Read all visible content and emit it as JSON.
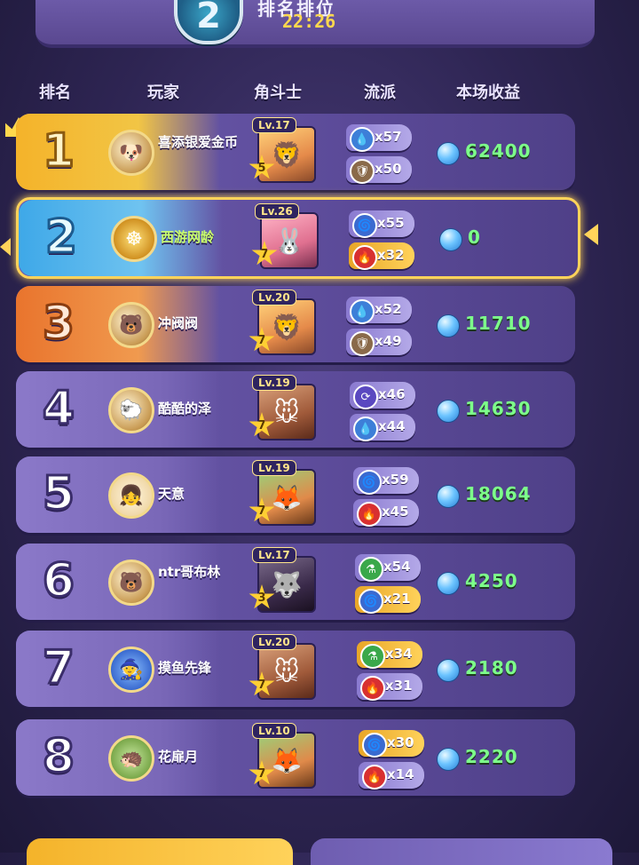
{
  "header": {
    "title": "排名排位",
    "rank_emblem": "2",
    "time": "22:26"
  },
  "columns": {
    "rank": "排名",
    "player": "玩家",
    "fighter": "角斗士",
    "school": "流派",
    "earnings": "本场收益"
  },
  "rows": [
    {
      "rank": "1",
      "name": "喜添银爱金币",
      "level": "Lv.17",
      "star": "5",
      "school_a": {
        "icon": "water-drop-icon",
        "count": "x57"
      },
      "school_b": {
        "icon": "shield-icon",
        "count": "x50"
      },
      "earnings": "62400"
    },
    {
      "rank": "2",
      "name": "西游网龄",
      "level": "Lv.26",
      "star": "7",
      "school_a": {
        "icon": "wind-icon",
        "count": "x55"
      },
      "school_b": {
        "icon": "flame-icon",
        "count": "x32"
      },
      "earnings": "0"
    },
    {
      "rank": "3",
      "name": "冲阀阀",
      "level": "Lv.20",
      "star": "7",
      "school_a": {
        "icon": "water-drop-icon",
        "count": "x52"
      },
      "school_b": {
        "icon": "shield-icon",
        "count": "x49"
      },
      "earnings": "11710"
    },
    {
      "rank": "4",
      "name": "酷酷的泽",
      "level": "Lv.19",
      "star": "7",
      "school_a": {
        "icon": "swirl-icon",
        "count": "x46"
      },
      "school_b": {
        "icon": "water-drop-icon",
        "count": "x44"
      },
      "earnings": "14630"
    },
    {
      "rank": "5",
      "name": "天意",
      "level": "Lv.19",
      "star": "7",
      "school_a": {
        "icon": "wind-icon",
        "count": "x59"
      },
      "school_b": {
        "icon": "flame-icon",
        "count": "x45"
      },
      "earnings": "18064"
    },
    {
      "rank": "6",
      "name": "ntr哥布林",
      "level": "Lv.17",
      "star": "3",
      "school_a": {
        "icon": "potion-icon",
        "count": "x54"
      },
      "school_b": {
        "icon": "wind-icon",
        "count": "x21"
      },
      "earnings": "4250"
    },
    {
      "rank": "7",
      "name": "摸鱼先锋",
      "level": "Lv.20",
      "star": "7",
      "school_a": {
        "icon": "potion-icon",
        "count": "x34"
      },
      "school_b": {
        "icon": "flame-icon",
        "count": "x31"
      },
      "earnings": "2180"
    },
    {
      "rank": "8",
      "name": "花扉月",
      "level": "Lv.10",
      "star": "7",
      "school_a": {
        "icon": "wind-icon",
        "count": "x30"
      },
      "school_b": {
        "icon": "flame-icon",
        "count": "x14"
      },
      "earnings": "2220"
    }
  ],
  "colors": {
    "earnings_text": "#7dff8a",
    "highlight_border": "#ffd35a",
    "rank1": "#f4b32a",
    "rank2": "#3ea8e8",
    "rank3": "#e9742d"
  }
}
